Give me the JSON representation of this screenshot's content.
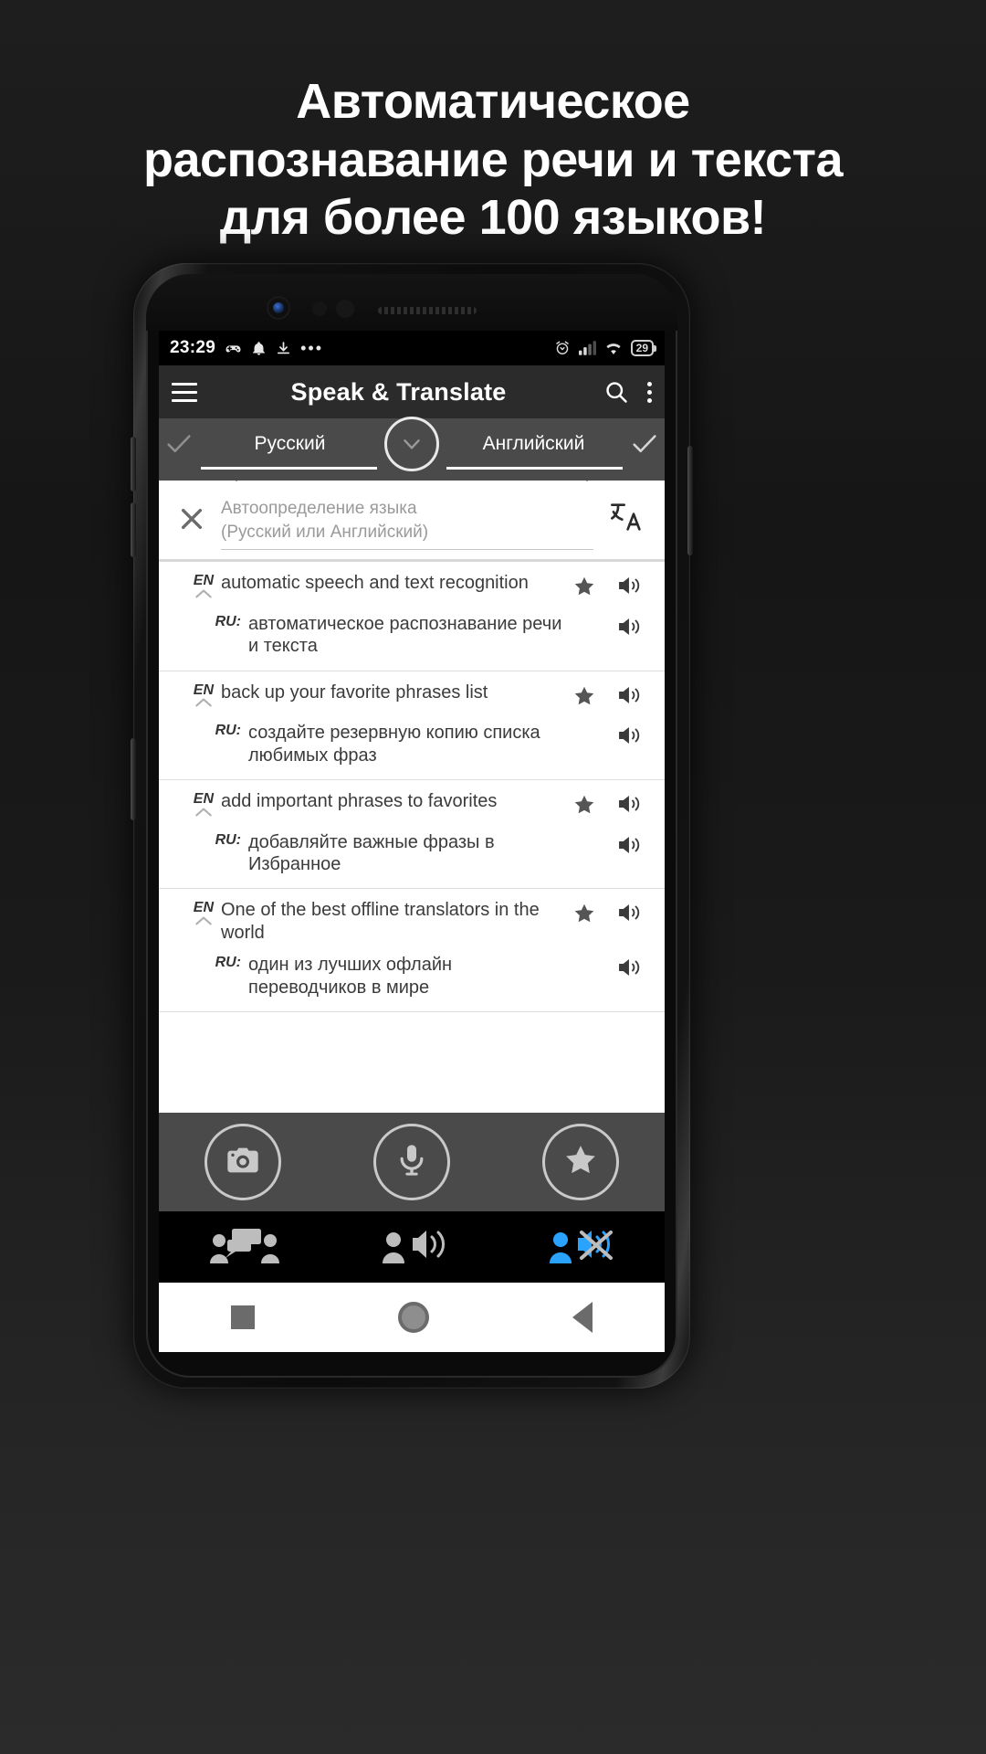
{
  "promo": {
    "headline_lines": [
      "Автоматическое",
      "распознавание речи и текста",
      "для более 100 языков!"
    ]
  },
  "status_bar": {
    "time": "23:29",
    "left_icons": [
      "game-controller-icon",
      "bell-icon",
      "download-icon",
      "more-dots-icon"
    ],
    "more_dots": "•••",
    "right_icons": [
      "alarm-icon",
      "signal-icon",
      "wifi-icon"
    ],
    "battery_level": "29"
  },
  "app_bar": {
    "menu_icon": "hamburger-menu-icon",
    "title": "Speak & Translate",
    "search_icon": "search-icon",
    "overflow_icon": "kebab-menu-icon"
  },
  "language_bar": {
    "source_language": "Русский",
    "target_language": "Английский",
    "source_check_icon": "check-icon",
    "target_check_icon": "check-icon",
    "swap_icon": "chevron-down-icon"
  },
  "input_area": {
    "clear_icon": "close-x-icon",
    "placeholder_line1": "Автоопределение языка",
    "placeholder_line2": "(Русский или Английский)",
    "value": "",
    "translate_icon": "translate-icon"
  },
  "translations": [
    {
      "source_tag": "EN",
      "source_text": "automatic speech and text recognition",
      "target_tag": "RU:",
      "target_text": "автоматическое распознавание речи и текста",
      "star_icon": "star-filled-icon",
      "speak_icon": "speaker-icon",
      "collapse_icon": "chevron-up-icon"
    },
    {
      "source_tag": "EN",
      "source_text": "back up your favorite phrases list",
      "target_tag": "RU:",
      "target_text": "создайте резервную копию списка любимых фраз",
      "star_icon": "star-filled-icon",
      "speak_icon": "speaker-icon",
      "collapse_icon": "chevron-up-icon"
    },
    {
      "source_tag": "EN",
      "source_text": "add important phrases to favorites",
      "target_tag": "RU:",
      "target_text": "добавляйте важные фразы в Избранное",
      "star_icon": "star-filled-icon",
      "speak_icon": "speaker-icon",
      "collapse_icon": "chevron-up-icon"
    },
    {
      "source_tag": "EN",
      "source_text": "One of the best offline translators in the world",
      "target_tag": "RU:",
      "target_text": "один из лучших офлайн переводчиков в мире",
      "star_icon": "star-filled-icon",
      "speak_icon": "speaker-icon",
      "collapse_icon": "chevron-up-icon"
    }
  ],
  "action_bar": {
    "buttons": [
      "camera-icon",
      "microphone-icon",
      "star-icon"
    ]
  },
  "mode_bar": {
    "buttons": [
      "conversation-mode-icon",
      "speak-aloud-icon",
      "mute-voice-icon"
    ],
    "active_color": "#29a3ff"
  },
  "nav_bar": {
    "recents_icon": "square-recents-icon",
    "home_icon": "circle-home-icon",
    "back_icon": "triangle-back-icon"
  }
}
